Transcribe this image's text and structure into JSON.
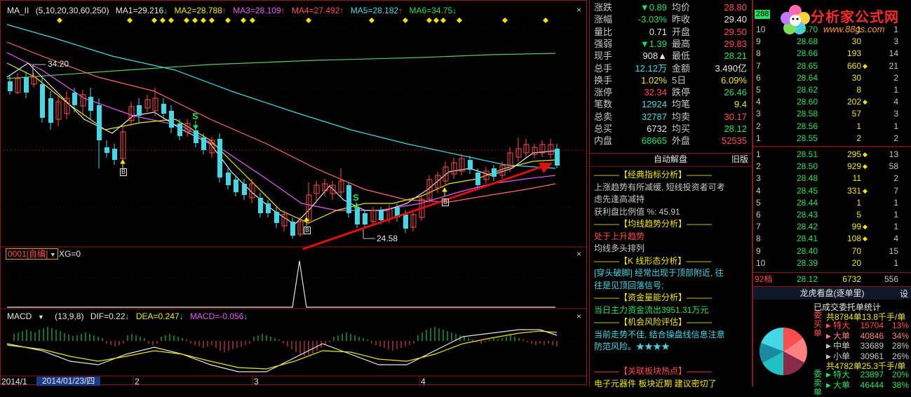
{
  "chart": {
    "ma_legend": {
      "name": "MA_II",
      "params": "(5,10,20,30,60,250)",
      "ma1": "MA1=29.216",
      "ma2": "MA2=28.788",
      "ma3": "MA3=28.109",
      "ma4": "MA4=27.492",
      "ma5": "MA5=28.182",
      "ma6": "MA6=34.75"
    },
    "high_label": "34.20",
    "low_label": "24.58",
    "indicator_selector": "0001[自编]",
    "xg_label": "XG=0",
    "macd_legend": {
      "name": "MACD",
      "params": "(13,9,8)",
      "dif": "DIF=0.22",
      "dea": "DEA=0.247",
      "macd": "MACD=-0.056"
    },
    "date_axis": {
      "start": "2014/1",
      "cursor": "2014/01/23/四",
      "m2": "2",
      "m3": "3",
      "m4": "4"
    },
    "signal_s": "S",
    "signal_b": "B"
  },
  "quote": {
    "rows": [
      {
        "l1": "涨跌",
        "v1": "▼0.89",
        "c1": "#22e05c",
        "l2": "均价",
        "v2": "28.80",
        "c2": "#ff4d4d"
      },
      {
        "l1": "涨幅",
        "v1": "-3.03%",
        "c1": "#22e05c",
        "l2": "昨收",
        "v2": "29.40",
        "c2": "#e6e6e6"
      },
      {
        "l1": "量比",
        "v1": "0.71",
        "c1": "#e6e6e6",
        "l2": "开盘",
        "v2": "29.50",
        "c2": "#ff4d4d"
      },
      {
        "l1": "强弱",
        "v1": "▼1.39",
        "c1": "#22e05c",
        "l2": "最高",
        "v2": "29.83",
        "c2": "#ff4d4d"
      },
      {
        "l1": "现手",
        "v1": "908▲",
        "c1": "#e6e6e6",
        "l2": "最低",
        "v2": "28.21",
        "c2": "#22e05c"
      },
      {
        "l1": "总手",
        "v1": "12.12万",
        "c1": "#44d7e6",
        "l2": "金额",
        "v2": "3.490亿",
        "c2": "#e6e6e6"
      },
      {
        "l1": "换手",
        "v1": "1.02%",
        "c1": "#f2e600",
        "l2": "5日",
        "v2": "6.09%",
        "c2": "#f2e600"
      },
      {
        "l1": "涨停",
        "v1": "32.34",
        "c1": "#ff4d4d",
        "l2": "跌停",
        "v2": "26.46",
        "c2": "#22e05c"
      },
      {
        "l1": "笔数",
        "v1": "12924",
        "c1": "#44d7e6",
        "l2": "均笔",
        "v2": "9.4",
        "c2": "#f2e600"
      },
      {
        "l1": "总卖",
        "v1": "32787",
        "c1": "#44d7e6",
        "l2": "均卖",
        "v2": "30.17",
        "c2": "#ff4d4d"
      },
      {
        "l1": "总买",
        "v1": "6732",
        "c1": "#e6e6e6",
        "l2": "均买",
        "v2": "28.12",
        "c2": "#22e05c"
      },
      {
        "l1": "内盘",
        "v1": "68665",
        "c1": "#22e05c",
        "l2": "外盘",
        "v2": "52535",
        "c2": "#ff4d4d"
      }
    ]
  },
  "analysis": {
    "title": "自动解盘",
    "old_btn": "旧版",
    "lines": [
      {
        "t": "———【经典指标分析】———",
        "c": "#f2e600"
      },
      {
        "t": "上涨趋势有所减缓, 短线投资者可考",
        "c": "#c8c8c8"
      },
      {
        "t": "虑先逢高减持",
        "c": "#c8c8c8"
      },
      {
        "t": "获利盘比例值 %: 45.91",
        "c": "#c8c8c8"
      },
      {
        "t": "———【均线趋势分析】———",
        "c": "#f2e600"
      },
      {
        "t": "处于上升趋势",
        "c": "#ff4d4d"
      },
      {
        "t": "均线多头排列",
        "c": "#c8c8c8"
      },
      {
        "t": "———【K 线形态分析】———",
        "c": "#f2e600"
      },
      {
        "t": "[穿头破脚] 经常出现于顶部附近, 往",
        "c": "#44d7e6"
      },
      {
        "t": "往是见顶回落信号;",
        "c": "#44d7e6"
      },
      {
        "t": "———【资金量能分析】———",
        "c": "#f2e600"
      },
      {
        "t": "当日主力资金流出3951.31万元",
        "c": "#22e05c"
      },
      {
        "t": "———【机会风险评估】———",
        "c": "#f2e600"
      },
      {
        "t": "当前走势不佳, 结合操盘线信息注意",
        "c": "#44d7e6"
      },
      {
        "t": "防范风险。★★★★",
        "c": "#44d7e6"
      },
      {
        "t": "",
        "c": "#c8c8c8"
      },
      {
        "t": "———【关联板块热点】———",
        "c": "#ff4d4d"
      },
      {
        "t": "电子元器件 板块近期 建议密切了",
        "c": "#f2e600"
      }
    ]
  },
  "depth": {
    "logo_main": "分析家公式网",
    "logo_url": "www.88gs.com",
    "code_fragment": "288",
    "sell": [
      {
        "lv": "10",
        "p": "28.70",
        "v": "1",
        "k": "",
        "c": "1"
      },
      {
        "lv": "9",
        "p": "28.68",
        "v": "30",
        "k": "",
        "c": "3"
      },
      {
        "lv": "8",
        "p": "28.66",
        "v": "193",
        "k": "",
        "c": "14"
      },
      {
        "lv": "7",
        "p": "28.65",
        "v": "660",
        "k": "◆",
        "c": "21"
      },
      {
        "lv": "6",
        "p": "28.64",
        "v": "30",
        "k": "",
        "c": "2"
      },
      {
        "lv": "5",
        "p": "28.62",
        "v": "8",
        "k": "",
        "c": "1"
      },
      {
        "lv": "4",
        "p": "28.60",
        "v": "202",
        "k": "◆",
        "c": "4"
      },
      {
        "lv": "3",
        "p": "28.58",
        "v": "57",
        "k": "",
        "c": "3"
      },
      {
        "lv": "2",
        "p": "28.56",
        "v": "1",
        "k": "",
        "c": "1"
      },
      {
        "lv": "1",
        "p": "28.55",
        "v": "2",
        "k": "",
        "c": "2"
      }
    ],
    "buy": [
      {
        "lv": "1",
        "p": "28.51",
        "v": "295",
        "k": "◆",
        "c": "13"
      },
      {
        "lv": "2",
        "p": "28.50",
        "v": "929",
        "k": "◆",
        "c": "58"
      },
      {
        "lv": "3",
        "p": "28.48",
        "v": "11",
        "k": "",
        "c": "2"
      },
      {
        "lv": "4",
        "p": "28.45",
        "v": "331",
        "k": "◆",
        "c": "7"
      },
      {
        "lv": "5",
        "p": "28.44",
        "v": "1",
        "k": "",
        "c": "1"
      },
      {
        "lv": "6",
        "p": "28.43",
        "v": "5",
        "k": "",
        "c": "1"
      },
      {
        "lv": "7",
        "p": "28.42",
        "v": "99",
        "k": "◆",
        "c": "1"
      },
      {
        "lv": "8",
        "p": "28.41",
        "v": "108",
        "k": "◆",
        "c": "4"
      },
      {
        "lv": "9",
        "p": "28.40",
        "v": "70",
        "k": "",
        "c": "15"
      },
      {
        "lv": "10",
        "p": "28.39",
        "v": "20",
        "k": "",
        "c": "1"
      }
    ],
    "footer": {
      "lbl": "92档",
      "p": "28.12",
      "v": "6732",
      "c": "556"
    }
  },
  "lhb": {
    "title": "龙虎看盘",
    "mode": "(逐单里)",
    "settings": "设",
    "subtitle": "已成交委托单统计",
    "buy_total": "共8784单13.8千手/单",
    "sell_total": "共4782单25.3千手/单",
    "side_buy": "委买单",
    "side_sell": "委卖单",
    "buy_rows": [
      {
        "n": "特大",
        "v": "15704",
        "p": "13%",
        "c": "#ff4d4d"
      },
      {
        "n": "大单",
        "v": "40846",
        "p": "34%",
        "c": "#ff8080"
      },
      {
        "n": "中单",
        "v": "33689",
        "p": "28%",
        "c": "#c8c8c8"
      },
      {
        "n": "小单",
        "v": "30961",
        "p": "26%",
        "c": "#c8c8c8"
      }
    ],
    "sell_rows": [
      {
        "n": "特大",
        "v": "23897",
        "p": "20%",
        "c": "#22e05c"
      },
      {
        "n": "大单",
        "v": "46444",
        "p": "38%",
        "c": "#22e05c"
      }
    ]
  }
}
